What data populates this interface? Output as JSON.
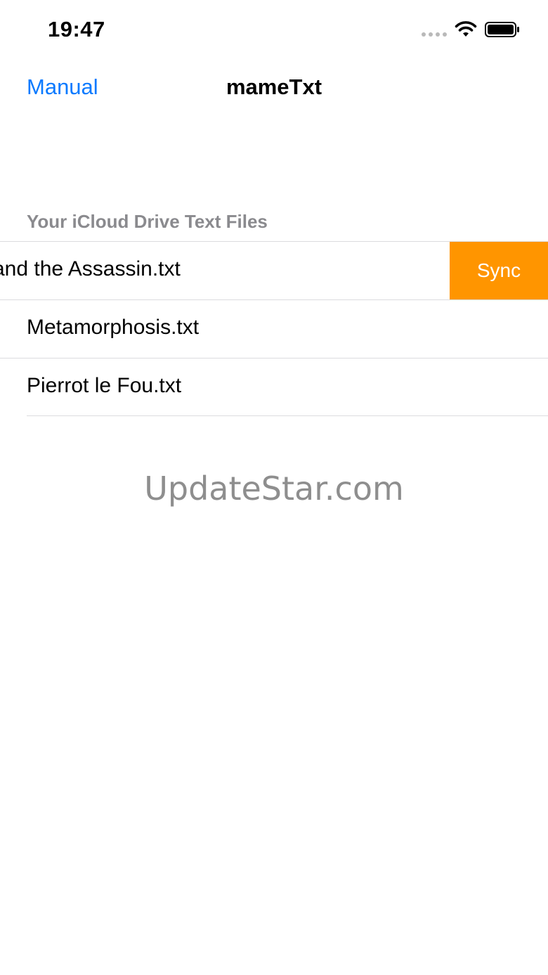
{
  "status_bar": {
    "time": "19:47",
    "icons": [
      "cellular-signal-icon",
      "wifi-icon",
      "battery-icon"
    ]
  },
  "nav_bar": {
    "back_label": "Manual",
    "title": "mameTxt",
    "accent_color": "#0a7aff"
  },
  "section": {
    "header": "Your iCloud Drive Text Files"
  },
  "files": [
    {
      "name": "and the Assassin.txt",
      "swipe_action": "Sync"
    },
    {
      "name": "Metamorphosis.txt"
    },
    {
      "name": "Pierrot le Fou.txt"
    }
  ],
  "swipe_action_color": "#ff9500",
  "watermark": "UpdateStar.com"
}
